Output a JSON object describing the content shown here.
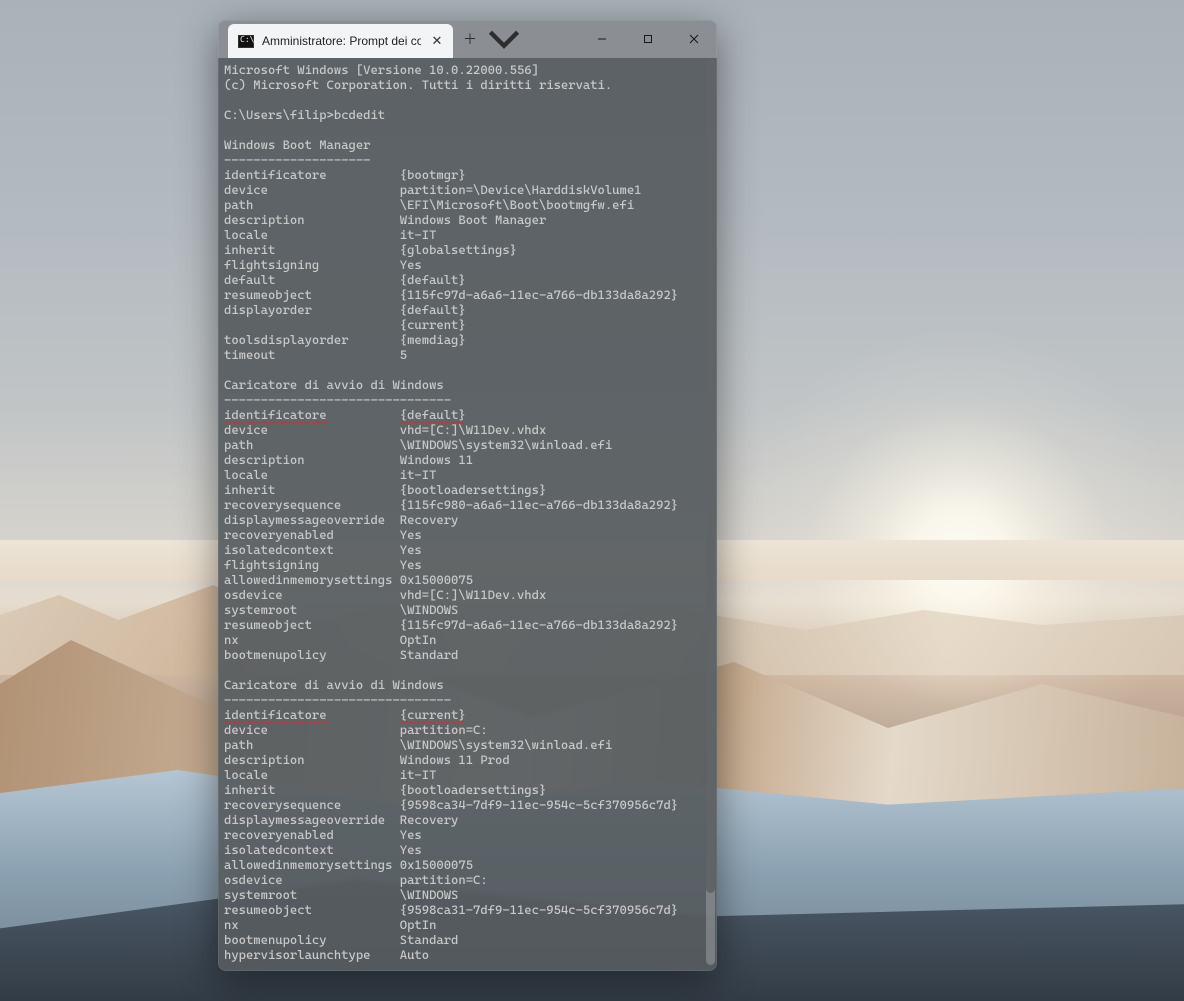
{
  "window": {
    "tab_title": "Amministratore: Prompt dei co"
  },
  "terminal": {
    "lines": [
      "Microsoft Windows [Versione 10.0.22000.556]",
      "(c) Microsoft Corporation. Tutti i diritti riservati.",
      "",
      "C:\\Users\\filip>bcdedit",
      "",
      "Windows Boot Manager",
      "--------------------"
    ],
    "section1_rows": [
      [
        "identificatore",
        "{bootmgr}"
      ],
      [
        "device",
        "partition=\\Device\\HarddiskVolume1"
      ],
      [
        "path",
        "\\EFI\\Microsoft\\Boot\\bootmgfw.efi"
      ],
      [
        "description",
        "Windows Boot Manager"
      ],
      [
        "locale",
        "it-IT"
      ],
      [
        "inherit",
        "{globalsettings}"
      ],
      [
        "flightsigning",
        "Yes"
      ],
      [
        "default",
        "{default}"
      ],
      [
        "resumeobject",
        "{115fc97d-a6a6-11ec-a766-db133da8a292}"
      ],
      [
        "displayorder",
        "{default}"
      ],
      [
        "",
        "{current}"
      ],
      [
        "toolsdisplayorder",
        "{memdiag}"
      ],
      [
        "timeout",
        "5"
      ]
    ],
    "section2_header": [
      "",
      "Caricatore di avvio di Windows",
      "-------------------------------"
    ],
    "section2_rows": [
      [
        "identificatore",
        "{default}",
        true,
        true
      ],
      [
        "device",
        "vhd=[C:]\\W11Dev.vhdx",
        false,
        false
      ],
      [
        "path",
        "\\WINDOWS\\system32\\winload.efi",
        false,
        false
      ],
      [
        "description",
        "Windows 11",
        true,
        true
      ],
      [
        "locale",
        "it-IT",
        false,
        false
      ],
      [
        "inherit",
        "{bootloadersettings}",
        false,
        false
      ],
      [
        "recoverysequence",
        "{115fc980-a6a6-11ec-a766-db133da8a292}",
        false,
        false
      ],
      [
        "displaymessageoverride",
        "Recovery",
        false,
        false
      ],
      [
        "recoveryenabled",
        "Yes",
        false,
        false
      ],
      [
        "isolatedcontext",
        "Yes",
        false,
        false
      ],
      [
        "flightsigning",
        "Yes",
        false,
        false
      ],
      [
        "allowedinmemorysettings",
        "0x15000075",
        false,
        false
      ],
      [
        "osdevice",
        "vhd=[C:]\\W11Dev.vhdx",
        false,
        false
      ],
      [
        "systemroot",
        "\\WINDOWS",
        false,
        false
      ],
      [
        "resumeobject",
        "{115fc97d-a6a6-11ec-a766-db133da8a292}",
        false,
        false
      ],
      [
        "nx",
        "OptIn",
        false,
        false
      ],
      [
        "bootmenupolicy",
        "Standard",
        false,
        false
      ]
    ],
    "section3_header": [
      "",
      "Caricatore di avvio di Windows",
      "-------------------------------"
    ],
    "section3_rows": [
      [
        "identificatore",
        "{current}",
        true,
        true
      ],
      [
        "device",
        "partition=C:",
        false,
        false
      ],
      [
        "path",
        "\\WINDOWS\\system32\\winload.efi",
        false,
        false
      ],
      [
        "description",
        "Windows 11 Prod",
        true,
        true
      ],
      [
        "locale",
        "it-IT",
        false,
        false
      ],
      [
        "inherit",
        "{bootloadersettings}",
        false,
        false
      ],
      [
        "recoverysequence",
        "{9598ca34-7df9-11ec-954c-5cf370956c7d}",
        false,
        false
      ],
      [
        "displaymessageoverride",
        "Recovery",
        false,
        false
      ],
      [
        "recoveryenabled",
        "Yes",
        false,
        false
      ],
      [
        "isolatedcontext",
        "Yes",
        false,
        false
      ],
      [
        "allowedinmemorysettings",
        "0x15000075",
        false,
        false
      ],
      [
        "osdevice",
        "partition=C:",
        false,
        false
      ],
      [
        "systemroot",
        "\\WINDOWS",
        false,
        false
      ],
      [
        "resumeobject",
        "{9598ca31-7df9-11ec-954c-5cf370956c7d}",
        false,
        false
      ],
      [
        "nx",
        "OptIn",
        false,
        false
      ],
      [
        "bootmenupolicy",
        "Standard",
        false,
        false
      ],
      [
        "hypervisorlaunchtype",
        "Auto",
        false,
        false
      ]
    ],
    "key_col_width": 24
  }
}
